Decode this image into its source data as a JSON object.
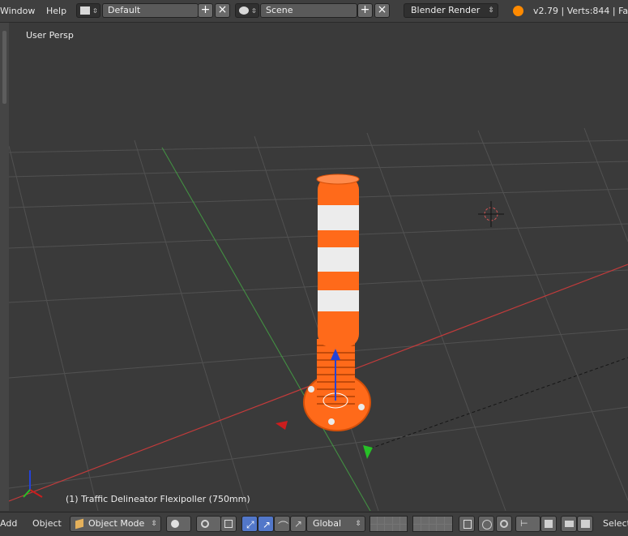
{
  "top": {
    "menu_window": "Window",
    "menu_help": "Help",
    "layout_value": "Default",
    "scene_value": "Scene",
    "render_engine": "Blender Render",
    "status": "v2.79 | Verts:844 | Fac"
  },
  "viewport": {
    "view_label": "User Persp",
    "object_label": "(1) Traffic Delineator Flexipoller (750mm)"
  },
  "bottom": {
    "add": "Add",
    "object": "Object",
    "mode": "Object Mode",
    "orientation": "Global",
    "select": "Select"
  },
  "colors": {
    "orange": "#ff6a1a",
    "white_band": "#ececec",
    "grid": "#575757",
    "x_axis": "#c23b3b",
    "y_axis": "#45a545",
    "z_axis": "#2443d8"
  }
}
